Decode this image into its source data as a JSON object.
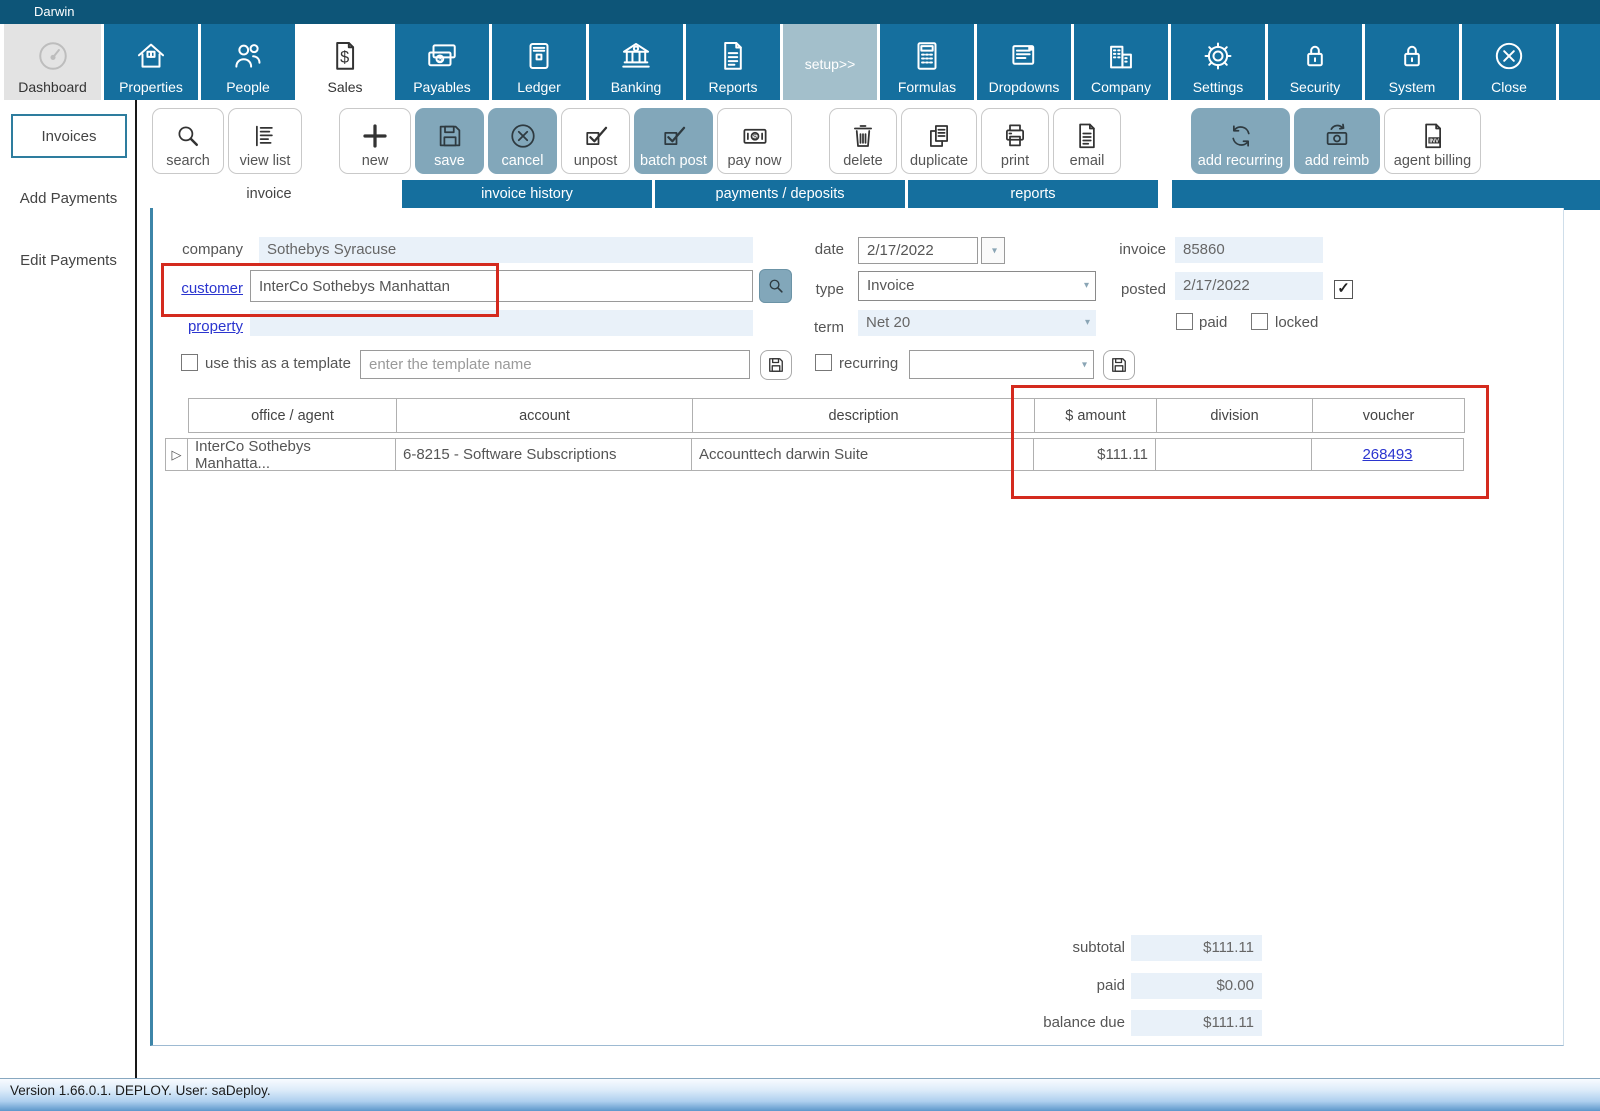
{
  "window": {
    "title": "Darwin"
  },
  "nav": {
    "items": [
      {
        "label": "Dashboard",
        "icon": "gauge-icon"
      },
      {
        "label": "Properties",
        "icon": "house-icon"
      },
      {
        "label": "People",
        "icon": "people-icon"
      },
      {
        "label": "Sales",
        "icon": "dollar-document-icon"
      },
      {
        "label": "Payables",
        "icon": "money-stack-icon"
      },
      {
        "label": "Ledger",
        "icon": "book-icon"
      },
      {
        "label": "Banking",
        "icon": "bank-icon"
      },
      {
        "label": "Reports",
        "icon": "document-lines-icon"
      },
      {
        "label": "setup>>",
        "icon": "none"
      },
      {
        "label": "Formulas",
        "icon": "calculator-icon"
      },
      {
        "label": "Dropdowns",
        "icon": "list-box-icon"
      },
      {
        "label": "Company",
        "icon": "building-icon"
      },
      {
        "label": "Settings",
        "icon": "gear-icon"
      },
      {
        "label": "Security",
        "icon": "lock-icon"
      },
      {
        "label": "System",
        "icon": "lock-icon"
      },
      {
        "label": "Close",
        "icon": "circle-x-icon"
      }
    ]
  },
  "sidebar": {
    "items": [
      {
        "label": "Invoices"
      },
      {
        "label": "Add Payments"
      },
      {
        "label": "Edit Payments"
      }
    ]
  },
  "actions": {
    "items": [
      {
        "label": "search",
        "icon": "magnifier-icon"
      },
      {
        "label": "view list",
        "icon": "list-lines-icon"
      },
      {
        "label": "new",
        "icon": "plus-icon"
      },
      {
        "label": "save",
        "icon": "floppy-icon"
      },
      {
        "label": "cancel",
        "icon": "circle-x-icon"
      },
      {
        "label": "unpost",
        "icon": "check-post-icon"
      },
      {
        "label": "batch post",
        "icon": "check-post-icon"
      },
      {
        "label": "pay now",
        "icon": "money-bill-icon"
      },
      {
        "label": "delete",
        "icon": "trash-icon"
      },
      {
        "label": "duplicate",
        "icon": "copy-icon"
      },
      {
        "label": "print",
        "icon": "printer-icon"
      },
      {
        "label": "email",
        "icon": "document-lines-icon"
      },
      {
        "label": "add recurring",
        "icon": "circular-arrows-icon"
      },
      {
        "label": "add reimb",
        "icon": "money-refresh-icon"
      },
      {
        "label": "agent billing",
        "icon": "invoice-document-icon"
      }
    ]
  },
  "tabs": {
    "items": [
      {
        "label": "invoice"
      },
      {
        "label": "invoice history"
      },
      {
        "label": "payments / deposits"
      },
      {
        "label": "reports"
      }
    ]
  },
  "form": {
    "company_label": "company",
    "company_value": "Sothebys Syracuse",
    "customer_label": "customer",
    "customer_value": "InterCo Sothebys Manhattan",
    "property_label": "property",
    "property_value": "",
    "date_label": "date",
    "date_value": "2/17/2022",
    "type_label": "type",
    "type_value": "Invoice",
    "term_label": "term",
    "term_value": "Net 20",
    "invoice_label": "invoice",
    "invoice_value": "85860",
    "posted_label": "posted",
    "posted_value": "2/17/2022",
    "posted_checked": "✓",
    "paid_label": "paid",
    "locked_label": "locked",
    "template_label": "use this as a template",
    "template_placeholder": "enter the template name",
    "recurring_label": "recurring"
  },
  "table": {
    "columns": [
      "office / agent",
      "account",
      "description",
      "$ amount",
      "division",
      "voucher"
    ],
    "rows": [
      {
        "office_agent": "InterCo Sothebys Manhatta...",
        "account": "6-8215 - Software Subscriptions",
        "description": "Accounttech darwin Suite",
        "amount": "$111.11",
        "division": "",
        "voucher": "268493"
      }
    ]
  },
  "totals": {
    "subtotal_label": "subtotal",
    "subtotal_value": "$111.11",
    "paid_label": "paid",
    "paid_value": "$0.00",
    "balance_label": "balance due",
    "balance_value": "$111.11"
  },
  "status": {
    "text": "Version 1.66.0.1.   DEPLOY. User: saDeploy."
  },
  "colors": {
    "titlebar": "#0d5578",
    "nav_teal": "#156f9e",
    "setup_gray": "#a3bfcb",
    "highlight_button": "#82a7ba",
    "field_blue": "#e9f1f9",
    "link_blue": "#2b35cf",
    "annotation_red": "#d42a1e",
    "status_gradient_bottom": "#5d97cb"
  }
}
